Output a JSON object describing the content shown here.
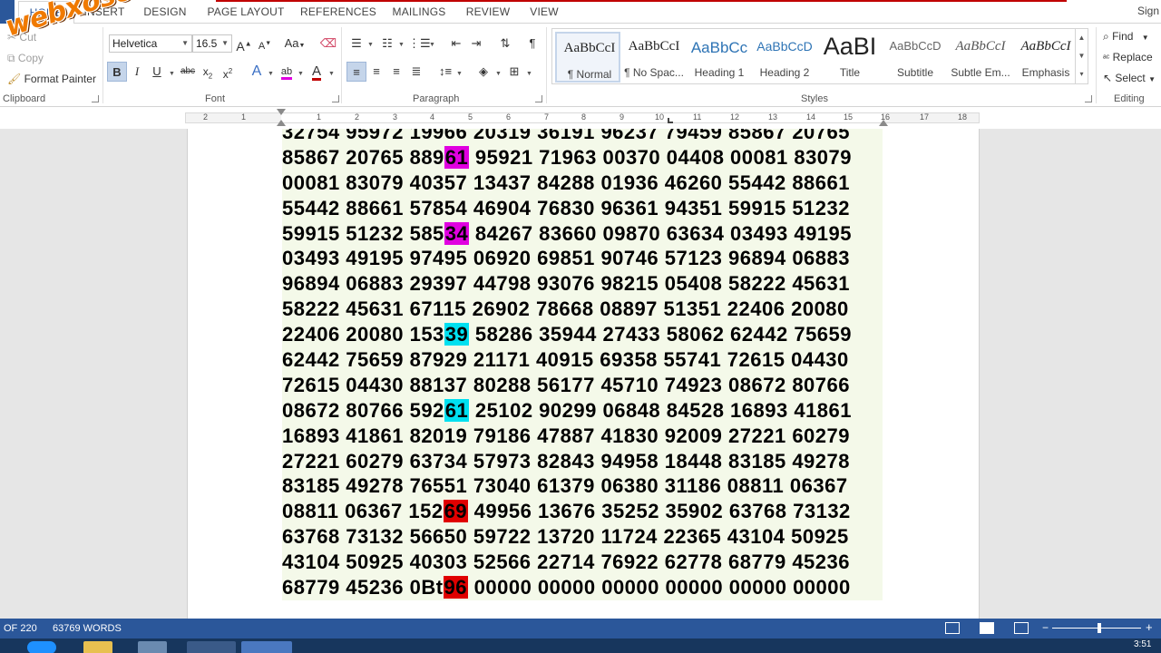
{
  "tabs": [
    "HOME",
    "INSERT",
    "DESIGN",
    "PAGE LAYOUT",
    "REFERENCES",
    "MAILINGS",
    "REVIEW",
    "VIEW"
  ],
  "sign_in": "Sign",
  "clipboard": {
    "cut": "Cut",
    "copy": "Copy",
    "format_painter": "Format Painter",
    "label": "Clipboard"
  },
  "font": {
    "name": "Helvetica",
    "size": "16.5",
    "label": "Font",
    "case_button": "Aa"
  },
  "paragraph": {
    "label": "Paragraph"
  },
  "styles": {
    "label": "Styles",
    "items": [
      {
        "preview": "AaBbCcI",
        "name": "¶ Normal"
      },
      {
        "preview": "AaBbCcI",
        "name": "¶ No Spac..."
      },
      {
        "preview": "AaBbCc",
        "name": "Heading 1"
      },
      {
        "preview": "AaBbCcD",
        "name": "Heading 2"
      },
      {
        "preview": "AaBI",
        "name": "Title"
      },
      {
        "preview": "AaBbCcD",
        "name": "Subtitle"
      },
      {
        "preview": "AaBbCcI",
        "name": "Subtle Em..."
      },
      {
        "preview": "AaBbCcI",
        "name": "Emphasis"
      }
    ]
  },
  "editing": {
    "find": "Find",
    "replace": "Replace",
    "select": "Select",
    "label": "Editing"
  },
  "ruler_numbers": [
    "2",
    "1",
    "1",
    "2",
    "3",
    "4",
    "5",
    "6",
    "7",
    "8",
    "9",
    "10",
    "11",
    "12",
    "13",
    "14",
    "15",
    "16",
    "17",
    "18"
  ],
  "watermark": "webxoso.net",
  "document_lines": [
    [
      {
        "t": "32754 95972 19966 20319 36191 96237 79459 85867 20765"
      }
    ],
    [
      {
        "t": "85867 20765 889"
      },
      {
        "t": "61",
        "hl": "magenta"
      },
      {
        "t": " 95921 71963 00370 04408 00081 83079"
      }
    ],
    [
      {
        "t": "00081 83079 40357 13437 84288 01936 46260 55442 88661"
      }
    ],
    [
      {
        "t": "55442 88661 57854 46904 76830 96361 94351 59915 51232"
      }
    ],
    [
      {
        "t": "59915 51232 585"
      },
      {
        "t": "34",
        "hl": "magenta"
      },
      {
        "t": " 84267 83660 09870 63634 03493 49195"
      }
    ],
    [
      {
        "t": "03493 49195 97495 06920 69851 90746 57123 96894 06883"
      }
    ],
    [
      {
        "t": "96894 06883 29397 44798 93076 98215 05408 58222 45631"
      }
    ],
    [
      {
        "t": "58222 45631 67115 26902 78668 08897 51351 22406 20080"
      }
    ],
    [
      {
        "t": "22406 20080 153"
      },
      {
        "t": "39",
        "hl": "cyan"
      },
      {
        "t": " 58286 35944 27433 58062 62442 75659"
      }
    ],
    [
      {
        "t": "62442 75659 87929 21171 40915 69358 55741 72615 04430"
      }
    ],
    [
      {
        "t": "72615 04430 88137 80288 56177 45710 74923 08672 80766"
      }
    ],
    [
      {
        "t": "08672 80766 592"
      },
      {
        "t": "61",
        "hl": "cyan"
      },
      {
        "t": " 25102 90299 06848 84528 16893 41861"
      }
    ],
    [
      {
        "t": "16893 41861 82019 79186 47887 41830 92009 27221 60279"
      }
    ],
    [
      {
        "t": "27221 60279 63734 57973 82843 94958 18448 83185 49278"
      }
    ],
    [
      {
        "t": "83185 49278 76551 73040 61379 06380 31186 08811 06367"
      }
    ],
    [
      {
        "t": "08811 06367 152"
      },
      {
        "t": "69",
        "hl": "red"
      },
      {
        "t": " 49956 13676 35252 35902 63768 73132"
      }
    ],
    [
      {
        "t": "63768 73132 56650 59722 13720 11724 22365 43104 50925"
      }
    ],
    [
      {
        "t": "43104 50925 40303 52566 22714 76922 62778 68779 45236"
      }
    ],
    [
      {
        "t": "68779 45236 0Bt"
      },
      {
        "t": "96",
        "hl": "red"
      },
      {
        "t": " 00000 00000 00000 00000 00000 00000"
      }
    ]
  ],
  "status": {
    "page": "OF 220",
    "words": "63769 WORDS"
  },
  "clock": "3:51",
  "colors": {
    "accent": "#2b579a",
    "highlight_magenta": "#e000e0",
    "highlight_cyan": "#00e0f0",
    "highlight_red": "#e00000",
    "block_bg": "#f4f9e9"
  }
}
